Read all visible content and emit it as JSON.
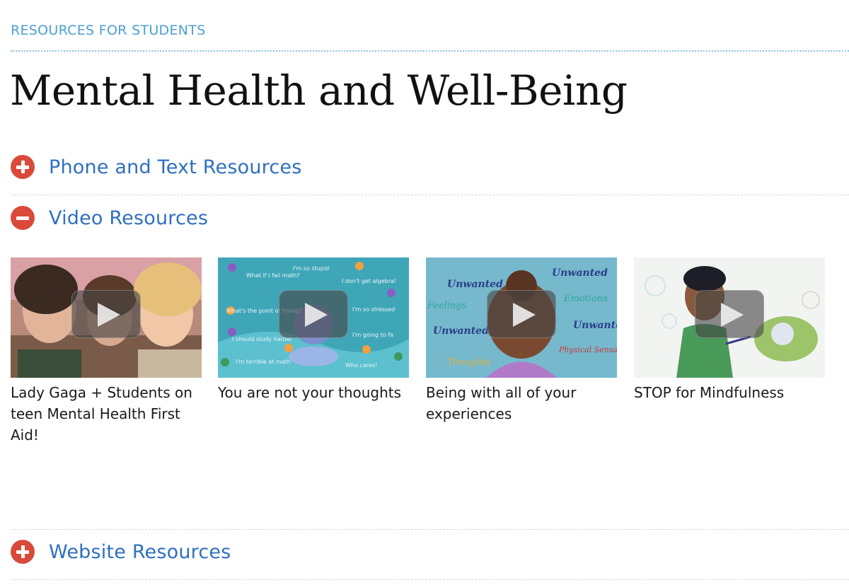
{
  "eyebrow": "RESOURCES FOR STUDENTS",
  "title": "Mental Health and Well-Being",
  "sections": [
    {
      "label": "Phone and Text Resources",
      "state": "collapsed",
      "icon": "plus-icon"
    },
    {
      "label": "Video Resources",
      "state": "expanded",
      "icon": "minus-icon"
    },
    {
      "label": "Website Resources",
      "state": "collapsed",
      "icon": "plus-icon"
    }
  ],
  "videos": [
    {
      "title": "Lady Gaga + Students on teen Mental Health First Aid!"
    },
    {
      "title": "You are not your thoughts",
      "thumb_words": [
        "What if I fail math?",
        "I'm so stupid",
        "I don't get algebra!",
        "What's the point of trying?",
        "I'm so stressed",
        "I should study harder",
        "I'm going to fa",
        "I'm terrible at math",
        "Who cares!"
      ]
    },
    {
      "title": "Being with all of your experiences",
      "thumb_words": [
        "Unwanted",
        "Unwanted",
        "Feelings",
        "Emotions",
        "Unwanted",
        "Unwanted",
        "Physical Sensations",
        "Thoughts"
      ]
    },
    {
      "title": "STOP for Mindfulness"
    }
  ],
  "colors": {
    "accent_red": "#d94a3a",
    "link_blue": "#2f6fbf",
    "eyebrow_blue": "#4a9fd1"
  }
}
